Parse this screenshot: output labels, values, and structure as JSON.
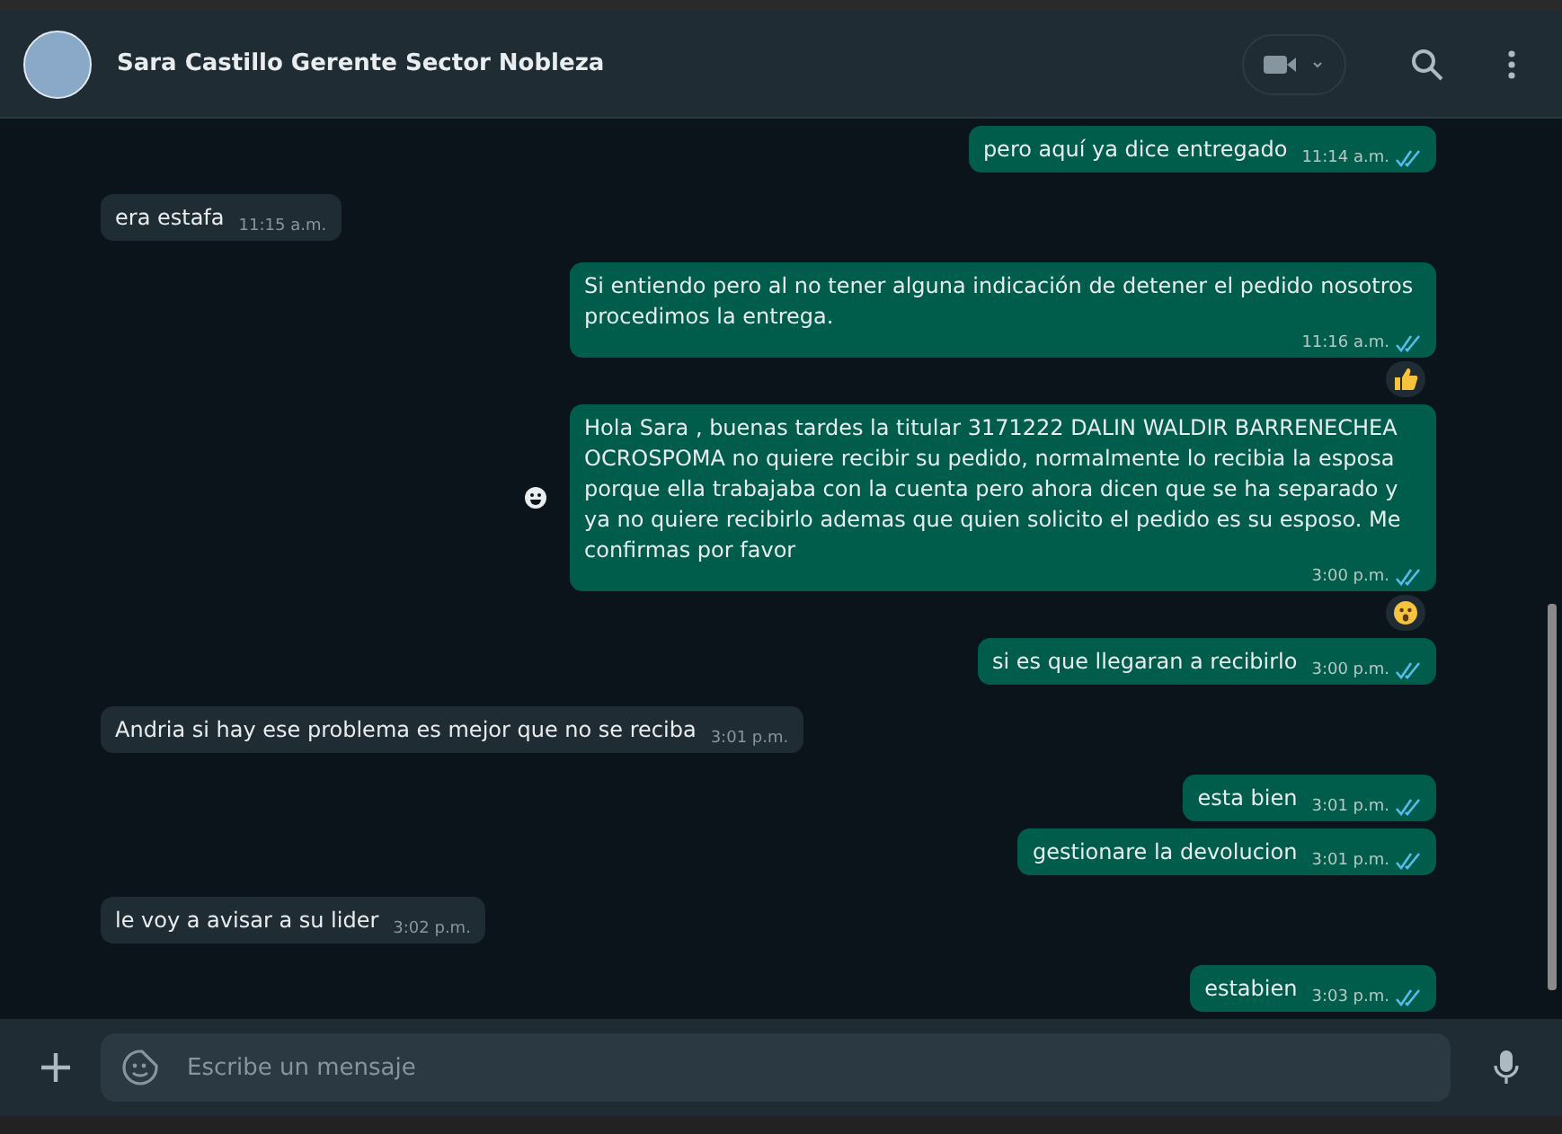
{
  "header": {
    "contact_name": "Sara Castillo Gerente Sector Nobleza"
  },
  "messages": [
    {
      "kind": "out",
      "text": "pero aquí ya dice entregado",
      "time": "11:14 a.m.",
      "read": true
    },
    {
      "kind": "in",
      "text": "era estafa",
      "time": "11:15 a.m."
    },
    {
      "kind": "out",
      "text": "Si entiendo pero al no tener alguna indicación de detener el pedido nosotros procedimos la entrega.",
      "time": "11:16 a.m.",
      "read": true,
      "reaction": {
        "kind": "thumbs_up"
      }
    },
    {
      "kind": "out",
      "text": "Hola Sara , buenas tardes la titular 3171222 DALIN WALDIR BARRENECHEA OCROSPOMA no quiere recibir su pedido, normalmente lo recibia la esposa porque ella trabajaba con la cuenta pero ahora dicen que se ha separado y ya no quiere recibirlo ademas que quien solicito el pedido es su esposo. Me confirmas por favor",
      "time": "3:00 p.m.",
      "read": true,
      "reaction": {
        "kind": "surprised"
      },
      "react_button": true
    },
    {
      "kind": "out",
      "text": "si es que llegaran a recibirlo",
      "time": "3:00 p.m.",
      "read": true
    },
    {
      "kind": "in",
      "text": "Andria si hay ese problema es mejor que no se reciba",
      "time": "3:01 p.m."
    },
    {
      "kind": "out",
      "text": "esta bien",
      "time": "3:01 p.m.",
      "read": true
    },
    {
      "kind": "out",
      "text": "gestionare la devolucion",
      "time": "3:01 p.m.",
      "read": true
    },
    {
      "kind": "in",
      "text": "le voy a avisar a su lider",
      "time": "3:02 p.m."
    },
    {
      "kind": "out",
      "text": "estabien",
      "time": "3:03 p.m.",
      "read": true
    }
  ],
  "composer": {
    "placeholder": "Escribe un mensaje"
  }
}
